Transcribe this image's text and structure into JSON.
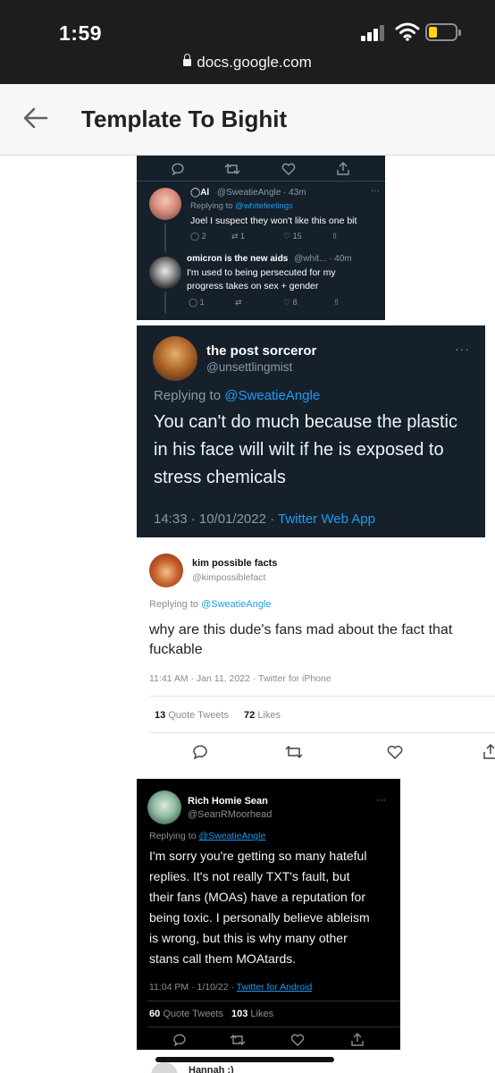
{
  "status": {
    "time": "1:59",
    "url": "docs.google.com"
  },
  "doc": {
    "title": "Template To Bighit"
  },
  "tweet1": {
    "reply1": {
      "name": "Al",
      "handle": "@SweatieAngle · 43m",
      "replying_prefix": "Replying to ",
      "replying_to": "@whitefeelings",
      "text": "Joel I suspect they won't like this one bit",
      "replies": "2",
      "retweets": "1",
      "likes": "15"
    },
    "reply2": {
      "name": "omicron is the new aids",
      "handle": "@whit... · 40m",
      "line1": "I'm used to being persecuted for my",
      "line2": "progress takes on sex + gender",
      "replies": "1",
      "likes": "8"
    }
  },
  "tweet2": {
    "name": "the post sorceror",
    "handle": "@unsettlingmist",
    "replying_prefix": "Replying to ",
    "replying_to": "@SweatieAngle",
    "line1": "You can't do much because the plastic",
    "line2": "in his face will wilt if he is exposed to",
    "line3": "stress chemicals",
    "meta": "14:33 · 10/01/2022 · ",
    "client": "Twitter Web App"
  },
  "tweet3": {
    "name": "kim possible facts",
    "handle": "@kimpossiblefact",
    "replying_prefix": "Replying to ",
    "replying_to": "@SweatieAngle",
    "line1": "why are this dude's fans mad about the fact that",
    "line2": "fuckable",
    "meta": "11:41 AM · Jan 11, 2022 · Twitter for iPhone",
    "quote_count": "13",
    "quote_label": "Quote Tweets",
    "like_count": "72",
    "like_label": "Likes"
  },
  "tweet4": {
    "name": "Rich Homie Sean",
    "handle": "@SeanRMoorhead",
    "replying_prefix": "Replying to ",
    "replying_to": "@SweatieAngle",
    "lines": [
      "I'm sorry you're getting so many hateful",
      "replies. It's not really TXT's fault, but",
      "their fans (MOAs) have a reputation for",
      "being toxic. I personally believe ableism",
      "is wrong, but this is why many other",
      "stans call them MOAtards."
    ],
    "meta": "11:04 PM · 1/10/22 · ",
    "client": "Twitter for Android",
    "quote_count": "60",
    "quote_label": "Quote Tweets",
    "like_count": "103",
    "like_label": "Likes"
  },
  "tweet5": {
    "name": "Hannah :)"
  }
}
